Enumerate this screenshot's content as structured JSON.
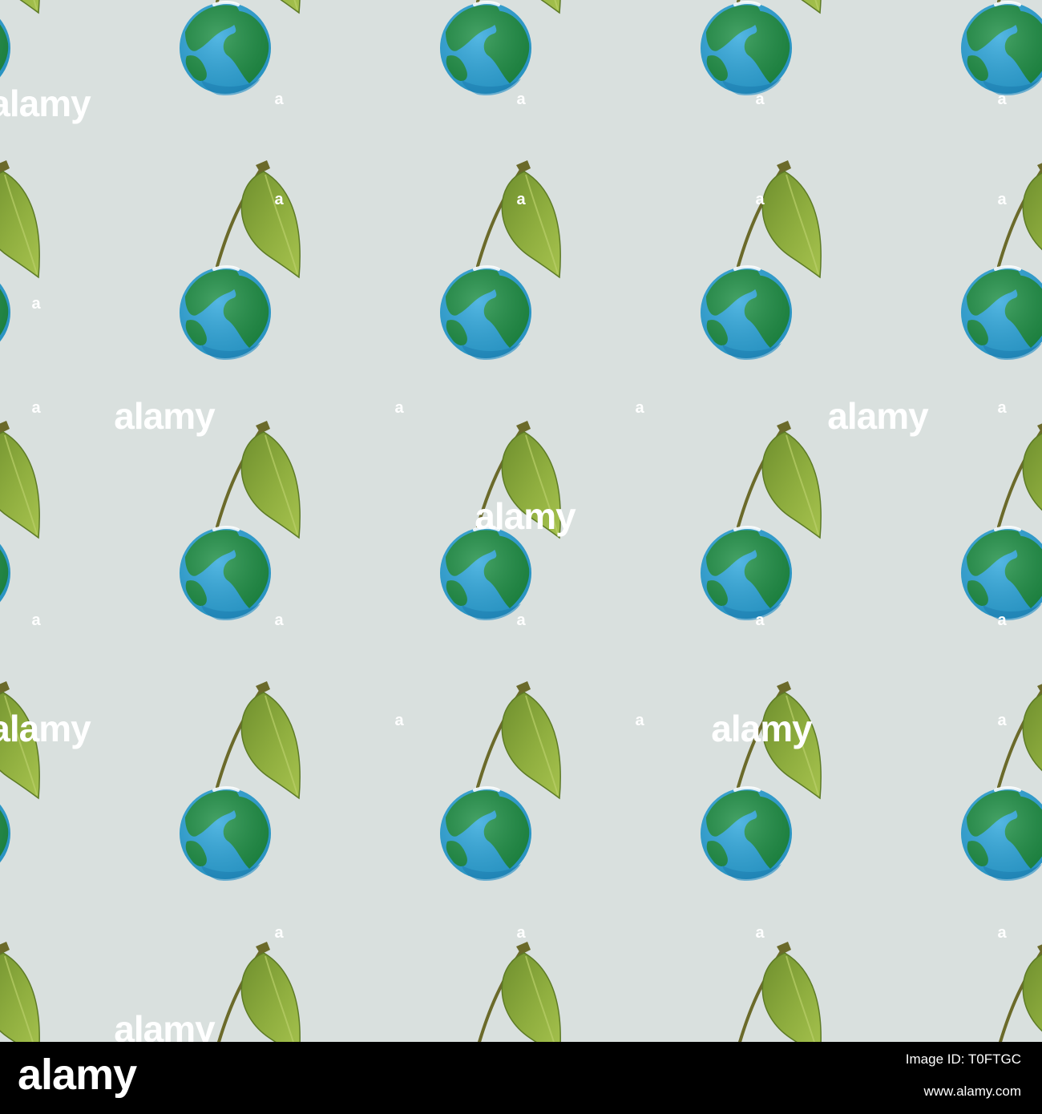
{
  "pattern": {
    "background_color": "#d9e0de",
    "motif": "earth-globe-cherry",
    "globe_ocean_color": "#2ea7dc",
    "globe_land_color": "#1e8f45",
    "leaf_color": "#8aab3c",
    "stem_color": "#6b6a2a"
  },
  "watermark": {
    "word": "alamy",
    "letter": "a",
    "color": "#ffffff"
  },
  "footer": {
    "background_color": "#000000",
    "logo": "alamy",
    "image_id": "Image ID: T0FTGC",
    "url": "www.alamy.com"
  }
}
